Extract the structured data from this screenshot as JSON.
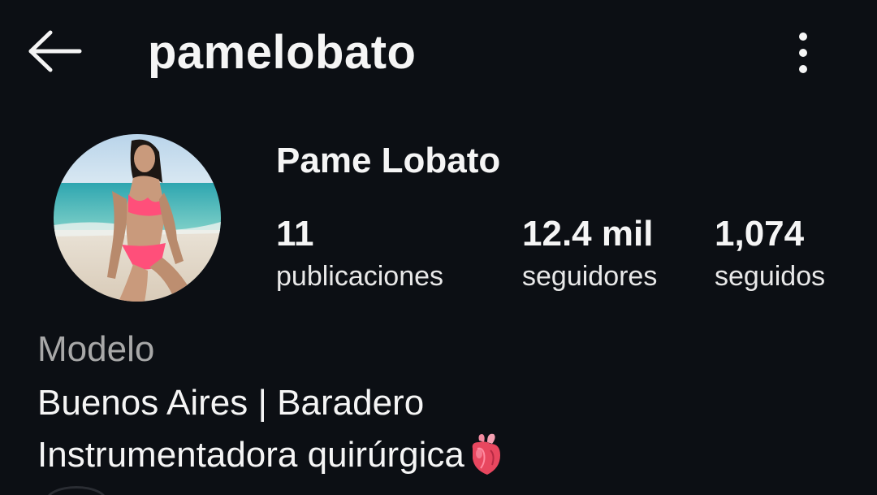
{
  "header": {
    "username": "pamelobato",
    "icons": {
      "back": "arrow-left-icon",
      "more": "more-vertical-icon"
    }
  },
  "profile": {
    "display_name": "Pame Lobato",
    "stats": {
      "posts": {
        "value": "11",
        "label": "publicaciones"
      },
      "followers": {
        "value": "12.4 mil",
        "label": "seguidores"
      },
      "following": {
        "value": "1,074",
        "label": "seguidos"
      }
    }
  },
  "bio": {
    "category": "Modelo",
    "lines": [
      "Buenos Aires | Baradero",
      "Instrumentadora quirúrgica"
    ],
    "emoji_icon": "anatomical-heart-icon"
  },
  "colors": {
    "background": "#0c0f14",
    "text": "#f5f5f5",
    "muted": "#a8a8a8"
  }
}
